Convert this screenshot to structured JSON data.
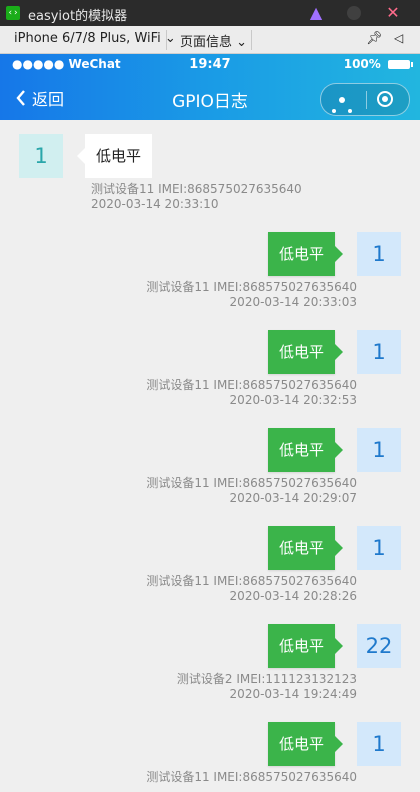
{
  "window": {
    "title": "easyiot的模拟器",
    "logo_text": "‹›"
  },
  "toolbar": {
    "device": "iPhone 6/7/8 Plus, WiFi ⌄",
    "page_info": "页面信息 ⌄"
  },
  "status_bar": {
    "carrier": "●●●●● WeChat",
    "time": "19:47",
    "battery": "100%"
  },
  "nav": {
    "back_label": "返回",
    "title": "GPIO日志"
  },
  "messages": [
    {
      "side": "left",
      "value": "1",
      "status": "低电平",
      "device": "测试设备11 IMEI:868575027635640",
      "time": "2020-03-14 20:33:10"
    },
    {
      "side": "right",
      "value": "1",
      "status": "低电平",
      "device": "测试设备11 IMEI:868575027635640",
      "time": "2020-03-14 20:33:03"
    },
    {
      "side": "right",
      "value": "1",
      "status": "低电平",
      "device": "测试设备11 IMEI:868575027635640",
      "time": "2020-03-14 20:32:53"
    },
    {
      "side": "right",
      "value": "1",
      "status": "低电平",
      "device": "测试设备11 IMEI:868575027635640",
      "time": "2020-03-14 20:29:07"
    },
    {
      "side": "right",
      "value": "1",
      "status": "低电平",
      "device": "测试设备11 IMEI:868575027635640",
      "time": "2020-03-14 20:28:26"
    },
    {
      "side": "right",
      "value": "22",
      "status": "低电平",
      "device": "测试设备2 IMEI:111123132123",
      "time": "2020-03-14 19:24:49"
    },
    {
      "side": "right",
      "value": "1",
      "status": "低电平",
      "device": "测试设备11 IMEI:868575027635640",
      "time": ""
    }
  ],
  "colors": {
    "nav_gradient_start": "#1677e8",
    "nav_gradient_end": "#22b6df",
    "bubble_green": "#3bb44a",
    "page_bg": "#efefef"
  }
}
